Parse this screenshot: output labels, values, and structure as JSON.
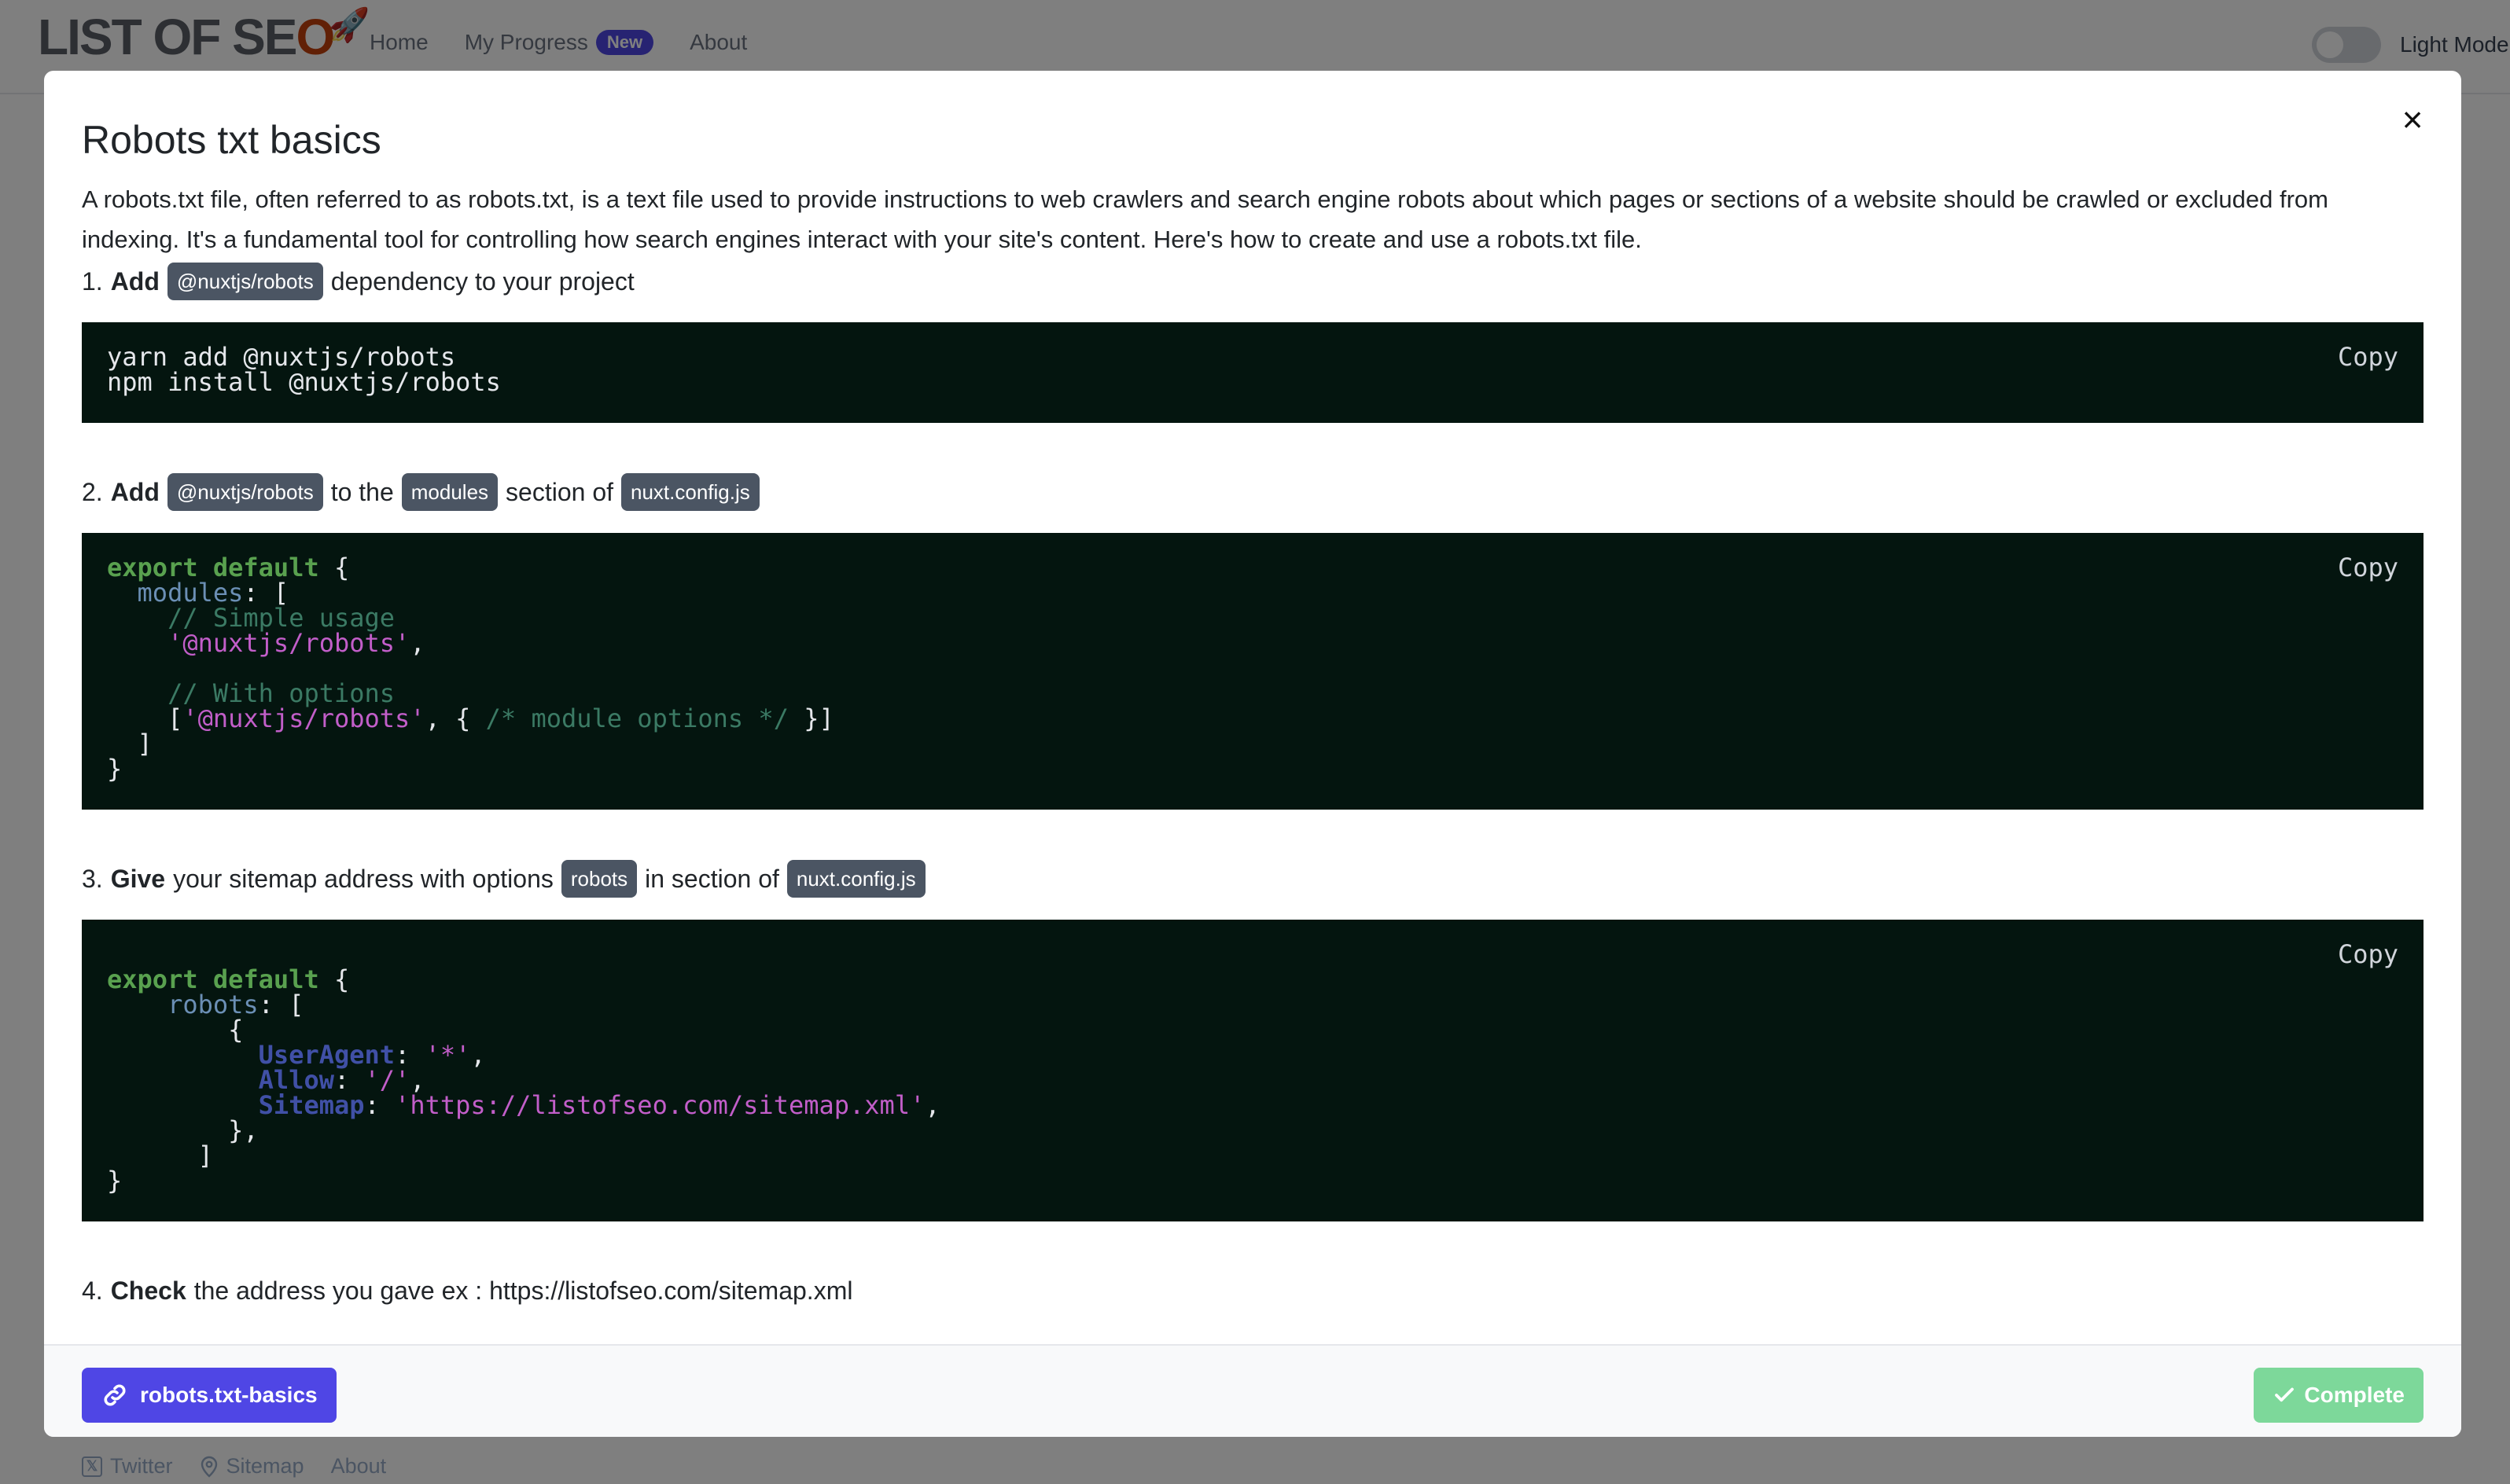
{
  "navbar": {
    "logo_left": "LIST OF SE",
    "logo_o": "O",
    "links": [
      {
        "label": "Home"
      },
      {
        "label": "My Progress",
        "badge": "New"
      },
      {
        "label": "About"
      }
    ],
    "mode_label": "Light Mode"
  },
  "modal": {
    "title": "Robots txt basics",
    "intro": "A robots.txt file, often referred to as robots.txt, is a text file used to provide instructions to web crawlers and search engine robots about which pages or sections of a website should be crawled or excluded from indexing. It's a fundamental tool for controlling how search engines interact with your site's content. Here's how to create and use a robots.txt file.",
    "step1": {
      "num": "1.",
      "verb": "Add",
      "chip": "@nuxtjs/robots",
      "rest": "dependency to your project"
    },
    "code1": {
      "line1": "yarn add @nuxtjs/robots",
      "line2": "npm install @nuxtjs/robots"
    },
    "step2": {
      "num": "2.",
      "verb": "Add",
      "chip1": "@nuxtjs/robots",
      "t1": "to the",
      "chip2": "modules",
      "t2": "section of",
      "chip3": "nuxt.config.js"
    },
    "code2": {
      "export_default": "export default",
      "modules": "modules",
      "comment1": "// Simple usage",
      "str1": "'@nuxtjs/robots'",
      "comment2": "// With options",
      "str2": "'@nuxtjs/robots'",
      "comment3": "/* module options */"
    },
    "step3": {
      "num": "3.",
      "verb": "Give",
      "t1": "your sitemap address with options",
      "chip1": "robots",
      "t2": "in section of",
      "chip2": "nuxt.config.js"
    },
    "code3": {
      "export_default": "export default",
      "robots": "robots",
      "useragent_key": "UserAgent",
      "useragent_val": "'*'",
      "allow_key": "Allow",
      "allow_val": "'/'",
      "sitemap_key": "Sitemap",
      "sitemap_val": "'https://listofseo.com/sitemap.xml'"
    },
    "copy_label": "Copy",
    "step4": {
      "num": "4.",
      "verb": "Check",
      "rest": "the address you gave ex : https://listofseo.com/sitemap.xml"
    },
    "footer": {
      "link_label": "robots.txt-basics",
      "complete_label": "Complete"
    }
  },
  "footer": {
    "links": [
      {
        "label": "Twitter"
      },
      {
        "label": "Sitemap"
      },
      {
        "label": "About"
      }
    ]
  }
}
